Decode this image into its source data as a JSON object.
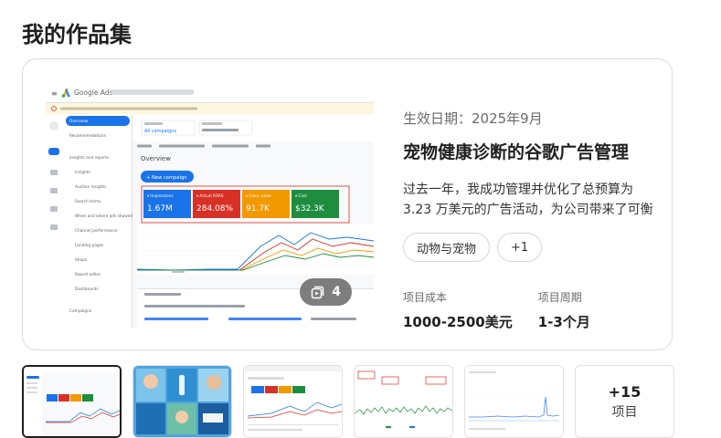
{
  "page": {
    "title": "我的作品集"
  },
  "portfolio": {
    "effective_date": "生效日期：2025年9月",
    "project_title": "宠物健康诊断的谷歌广告管理",
    "description": "过去一年，我成功管理并优化了总预算为 3.23 万美元的广告活动，为公司带来了可衡",
    "tags": [
      "动物与宠物",
      "+1"
    ],
    "media_count": "4",
    "stats": [
      {
        "label": "项目成本",
        "value": "1000-2500美元"
      },
      {
        "label": "项目周期",
        "value": "1-3个月"
      }
    ]
  },
  "screenshot": {
    "brand": "Google Ads",
    "sidebar_items": [
      "Overview",
      "Recommendations",
      "Insights and reports",
      "Insights",
      "Auction insights",
      "Search terms",
      "When and where ads showed",
      "Channel performance",
      "Landing pages",
      "Shops",
      "Report editor",
      "Dashboards",
      "Campaigns"
    ],
    "filter_label": "All campaigns",
    "section_title": "Overview",
    "new_campaign": "+ New campaign",
    "metrics": [
      {
        "label": "Impressions",
        "value": "1.67M",
        "color": "#1a73e8"
      },
      {
        "label": "Actual ROAS",
        "value": "284.08%",
        "color": "#d93025"
      },
      {
        "label": "Conv. value",
        "value": "91.7K",
        "color": "#f29900"
      },
      {
        "label": "Cost",
        "value": "$32.3K",
        "color": "#1e8e3e"
      }
    ]
  },
  "thumbnails": {
    "more_count": "+15",
    "more_label": "项目"
  },
  "colors": {
    "accent": "#1a73e8",
    "border": "#dcdcdc",
    "text": "#1f1f1f",
    "muted": "#6b6b6b"
  }
}
